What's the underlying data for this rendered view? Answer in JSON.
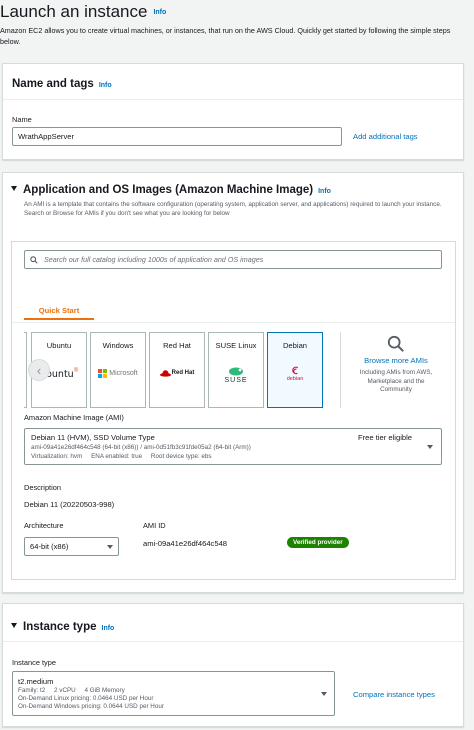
{
  "page": {
    "title": "Launch an instance",
    "info": "Info",
    "description": "Amazon EC2 allows you to create virtual machines, or instances, that run on the AWS Cloud. Quickly get started by following the simple steps below."
  },
  "name_tags": {
    "title": "Name and tags",
    "info": "Info",
    "name_label": "Name",
    "name_value": "WrathAppServer",
    "add_tags": "Add additional tags"
  },
  "ami": {
    "title": "Application and OS Images (Amazon Machine Image)",
    "info": "Info",
    "description": "An AMI is a template that contains the software configuration (operating system, application server, and applications) required to launch your instance. Search or Browse for AMIs if you don't see what you are looking for below",
    "search_placeholder": "Search our full catalog including 1000s of application and OS images",
    "tab_quick_start": "Quick Start",
    "tiles": [
      {
        "name": "Ubuntu",
        "logo_text": "ubuntu",
        "logo_mark": "®"
      },
      {
        "name": "Windows",
        "logo_text": "Microsoft"
      },
      {
        "name": "Red Hat",
        "logo_text": "Red Hat"
      },
      {
        "name": "SUSE Linux",
        "logo_text": "SUSE"
      },
      {
        "name": "Debian",
        "logo_text": "debian"
      }
    ],
    "browse_more": "Browse more AMIs",
    "browse_desc": "Including AMIs from AWS, Marketplace and the Community",
    "ami_label": "Amazon Machine Image (AMI)",
    "ami_selected_name": "Debian 11 (HVM), SSD Volume Type",
    "ami_free_tier": "Free tier eligible",
    "ami_ids_line": "ami-09a41e26df464c548 (64-bit (x86)) / ami-0d51fb3c91fde05a2 (64-bit (Arm))",
    "ami_virt_line": "Virtualization: hvm     ENA enabled: true     Root device type: ebs",
    "description_label": "Description",
    "description_value": "Debian 11 (20220503-998)",
    "architecture_label": "Architecture",
    "architecture_value": "64-bit (x86)",
    "ami_id_label": "AMI ID",
    "ami_id_value": "ami-09a41e26df464c548",
    "verified": "Verified provider"
  },
  "instance_type": {
    "title": "Instance type",
    "info": "Info",
    "label": "Instance type",
    "value": "t2.medium",
    "line1": "Family: t2     2 vCPU     4 GiB Memory",
    "line2": "On-Demand Linux pricing: 0.0464 USD per Hour",
    "line3": "On-Demand Windows pricing: 0.0644 USD per Hour",
    "compare": "Compare instance types"
  },
  "colors": {
    "link": "#0073bb",
    "tab_active": "#ec7211",
    "verified_badge": "#1d8102",
    "selected_tile_border": "#0073bb"
  }
}
